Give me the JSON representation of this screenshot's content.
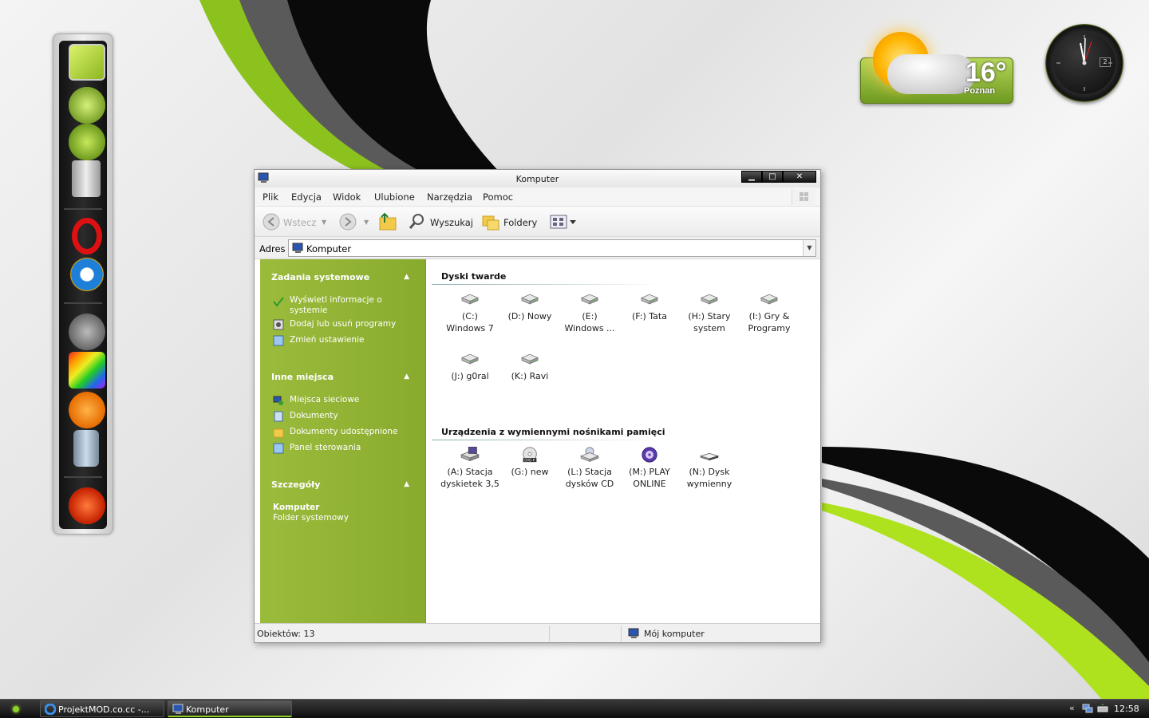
{
  "widgets": {
    "weather": {
      "temperature": "16°",
      "city": "Poznan"
    },
    "clock": {
      "date": "2"
    }
  },
  "dock": {
    "items": [
      "monitor-icon",
      "network-icon",
      "network-icon-2",
      "recycle-bin-icon",
      "opera-icon",
      "ie-icon",
      "gimp-icon",
      "puzzle-icon",
      "snippet-icon",
      "paint-icon",
      "ps09-icon"
    ]
  },
  "window": {
    "title": "Komputer",
    "menu": [
      "Plik",
      "Edycja",
      "Widok",
      "Ulubione",
      "Narzędzia",
      "Pomoc"
    ],
    "toolbar": {
      "back": "Wstecz",
      "search": "Wyszukaj",
      "folders": "Foldery"
    },
    "address": {
      "label": "Adres",
      "value": "Komputer"
    },
    "taskpane": {
      "system_tasks": {
        "header": "Zadania systemowe",
        "links": [
          "Wyświetl informacje o systemie",
          "Dodaj lub usuń programy",
          "Zmień ustawienie"
        ]
      },
      "other_places": {
        "header": "Inne miejsca",
        "links": [
          "Miejsca sieciowe",
          "Dokumenty",
          "Dokumenty udostępnione",
          "Panel sterowania"
        ]
      },
      "details": {
        "header": "Szczegóły",
        "name": "Komputer",
        "type": "Folder systemowy"
      }
    },
    "content": {
      "hard_drives": {
        "title": "Dyski twarde",
        "items": [
          "(C:)\nWindows 7",
          "(D:) Nowy",
          "(E:)\nWindows ...",
          "(F:) Tata",
          "(H:) Stary\nsystem",
          "(I:) Gry &\nProgramy",
          "(J:) g0ral",
          "(K:) Ravi"
        ]
      },
      "removable": {
        "title": "Urządzenia z wymiennymi nośnikami pamięci",
        "items": [
          "(A:) Stacja\ndyskietek 3,5",
          "(G:) new",
          "(L:) Stacja\ndysków CD",
          "(M:) PLAY\nONLINE",
          "(N:) Dysk\nwymienny"
        ]
      }
    },
    "statusbar": {
      "objects": "Obiektów: 13",
      "location": "Mój komputer"
    }
  },
  "taskbar": {
    "buttons": [
      "ProjektMOD.co.cc -...",
      "Komputer"
    ],
    "time": "12:58"
  },
  "colors": {
    "accent_green": "#8ab62a",
    "taskpane_green": "#9bbb3c"
  }
}
